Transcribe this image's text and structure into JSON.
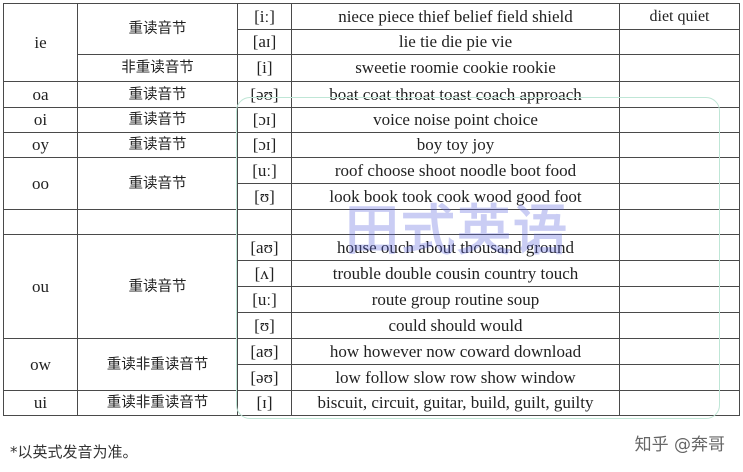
{
  "table": {
    "groups": [
      {
        "letters": "ie",
        "rows": [
          {
            "stress": "重读音节",
            "ipa": "[iː]",
            "words": "niece piece thief belief field shield",
            "extra": "diet quiet"
          },
          {
            "ipa": "[aɪ]",
            "words": "lie tie die pie vie",
            "extra": ""
          },
          {
            "stress": "非重读音节",
            "ipa": "[i]",
            "words": "sweetie roomie cookie rookie",
            "extra": ""
          }
        ]
      },
      {
        "letters": "oa",
        "rows": [
          {
            "stress": "重读音节",
            "ipa": "[əʊ]",
            "words": "boat coat throat toast coach approach",
            "extra": ""
          }
        ]
      },
      {
        "letters": "oi",
        "rows": [
          {
            "stress": "重读音节",
            "ipa": "[ɔɪ]",
            "words": "voice noise point choice",
            "extra": ""
          }
        ]
      },
      {
        "letters": "oy",
        "rows": [
          {
            "stress": "重读音节",
            "ipa": "[ɔɪ]",
            "words": "boy toy joy",
            "extra": ""
          }
        ]
      },
      {
        "letters": "oo",
        "rows": [
          {
            "stress": "重读音节",
            "ipa": "[uː]",
            "words": "roof choose shoot noodle boot food",
            "extra": ""
          },
          {
            "ipa": "[ʊ]",
            "words": "look book took cook wood good foot",
            "extra": ""
          }
        ]
      },
      {
        "letters": "",
        "rows": [
          {
            "stress": "",
            "ipa": "",
            "words": "",
            "extra": ""
          }
        ]
      },
      {
        "letters": "ou",
        "rows": [
          {
            "stress": "重读音节",
            "ipa": "[aʊ]",
            "words": "house ouch about thousand ground",
            "extra": ""
          },
          {
            "ipa": "[ʌ]",
            "words": "trouble double cousin country touch",
            "extra": ""
          },
          {
            "ipa": "[uː]",
            "words": "route group routine soup",
            "extra": ""
          },
          {
            "ipa": "[ʊ]",
            "words": "could should would",
            "extra": ""
          }
        ]
      },
      {
        "letters": "ow",
        "rows": [
          {
            "stress": "重读非重读音节",
            "ipa": "[aʊ]",
            "words": "how however now coward download",
            "extra": ""
          },
          {
            "ipa": "[əʊ]",
            "words": "low follow slow row show window",
            "extra": ""
          }
        ]
      },
      {
        "letters": "ui",
        "rows": [
          {
            "stress": "重读非重读音节",
            "ipa": "[ɪ]",
            "words": "biscuit, circuit, guitar, build, guilt, guilty",
            "extra": ""
          }
        ]
      }
    ]
  },
  "watermark": "田式英语",
  "footnote": "*以英式发音为准。",
  "source_label": "知乎 @奔哥",
  "colors": {
    "border": "#4a4a4a",
    "watermark": "#5a64dc",
    "frame": "#bfe6d6"
  }
}
